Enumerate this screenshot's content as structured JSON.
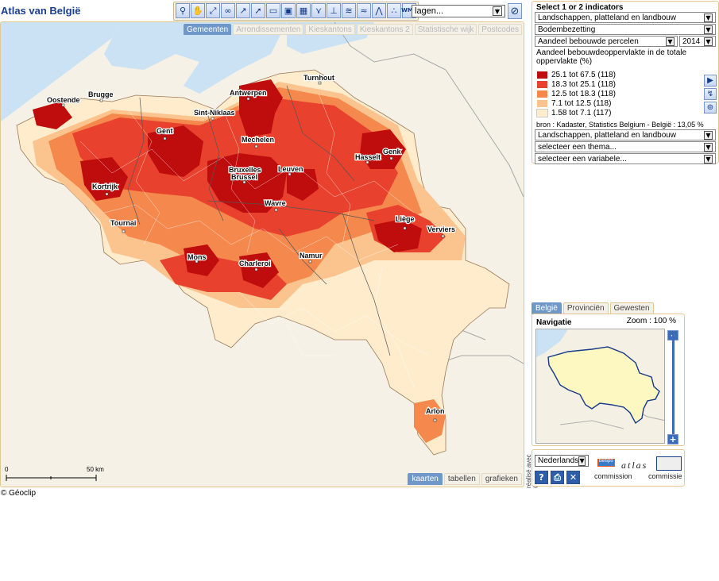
{
  "app": {
    "title": "Atlas van België",
    "copyright": "© Géoclip",
    "credit": "réalisé avec Géoclip"
  },
  "toolbar": {
    "tools": [
      "zoom-icon",
      "pan-icon",
      "zoom-extent-icon",
      "binoculars-icon",
      "select-icon",
      "pointer-icon",
      "folder-icon",
      "save-icon",
      "table-icon",
      "chart-icon",
      "print-icon",
      "layers-icon",
      "waves-icon",
      "chart-line-icon",
      "scatter-icon",
      "wms-icon"
    ],
    "wms_label": "WMS",
    "layers_value": "lagen...",
    "clear_icon": "no-icon"
  },
  "map": {
    "levels": [
      {
        "label": "Gemeenten",
        "active": true
      },
      {
        "label": "Arrondissementen",
        "active": false
      },
      {
        "label": "Kieskantons",
        "active": false
      },
      {
        "label": "Kieskantons 2",
        "active": false
      },
      {
        "label": "Statistische wijk",
        "active": false
      },
      {
        "label": "Postcodes",
        "active": false
      }
    ],
    "cities": [
      "Oostende",
      "Brugge",
      "Gent",
      "Sint-Niklaas",
      "Antwerpen",
      "Turnhout",
      "Mechelen",
      "Bruxelles",
      "Brussel",
      "Leuven",
      "Hasselt",
      "Genk",
      "Kortrijk",
      "Wavre",
      "Tournai",
      "Liège",
      "Verviers",
      "Mons",
      "Charleroi",
      "Namur",
      "Arlon"
    ],
    "scale": {
      "min": "0",
      "max": "50 km"
    },
    "views": [
      {
        "label": "kaarten",
        "active": true
      },
      {
        "label": "tabellen",
        "active": false
      },
      {
        "label": "grafieken",
        "active": false
      }
    ],
    "colors": {
      "sea": "#cbe2f5",
      "neighbours": "#f5f1e6",
      "class1": "#bf0d0d",
      "class2": "#e8422e",
      "class3": "#f5894d",
      "class4": "#fbc48e",
      "class5": "#feeccd"
    }
  },
  "indicators": {
    "header_prefix": "Select ",
    "header_strong": "1",
    "header_suffix": " or 2 indicators",
    "theme1": "Landschappen, platteland en landbouw",
    "theme2": "Bodembezetting",
    "variable": "Aandeel bebouwde percelen",
    "year": "2014",
    "description": "Aandeel bebouwdeoppervlakte in de totale oppervlakte (%)",
    "legend": [
      {
        "label": "25.1 tot 67.5 (118)",
        "color": "#bf0d0d"
      },
      {
        "label": "18.3 tot 25.1 (118)",
        "color": "#e8422e"
      },
      {
        "label": "12.5 tot 18.3 (118)",
        "color": "#f5894d"
      },
      {
        "label": "7.1 tot 12.5 (118)",
        "color": "#fbc48e"
      },
      {
        "label": "1.58 tot 7.1 (117)",
        "color": "#feeccd"
      }
    ],
    "source": "bron : Kadaster, Statistics Belgium - België : 13,05 %",
    "second_theme": "Landschappen, platteland en landbouw",
    "second_subtheme": "selecteer een thema...",
    "second_variable": "selecteer een variabele..."
  },
  "navigation": {
    "tabs": [
      {
        "label": "België",
        "active": true
      },
      {
        "label": "Provinciën",
        "active": false
      },
      {
        "label": "Gewesten",
        "active": false
      }
    ],
    "label": "Navigatie",
    "zoom": "Zoom : 100 %"
  },
  "footer": {
    "language": "Nederlands",
    "belspo_top": "belspo",
    "belspo": "commission",
    "atlas": "atlas",
    "commissie": "commissie"
  }
}
